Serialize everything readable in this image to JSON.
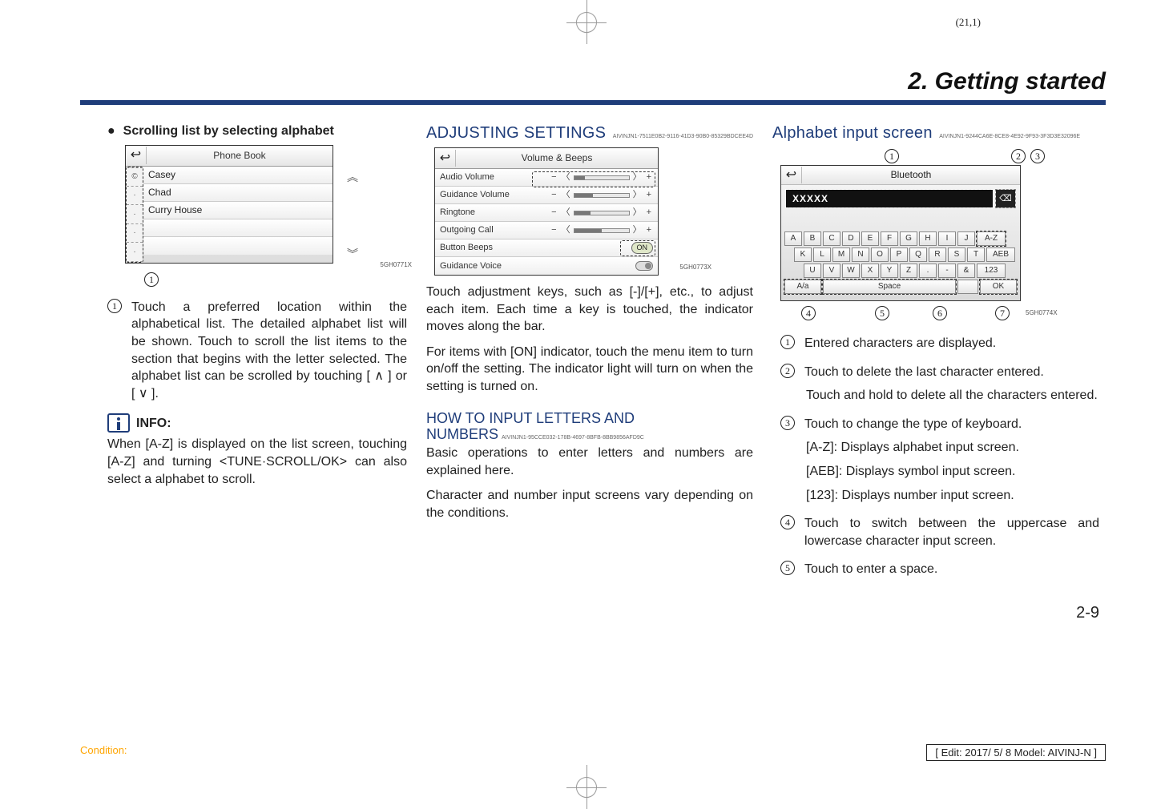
{
  "meta": {
    "page_coord": "(21,1)",
    "chapter_title": "2. Getting started",
    "page_number": "2-9",
    "footer_condition": "Condition:",
    "footer_edit": "[ Edit: 2017/ 5/ 8   Model: AIVINJ-N ]"
  },
  "col1": {
    "bullet_heading": "Scrolling list by selecting alphabet",
    "fig": {
      "header_title": "Phone Book",
      "rows": [
        "Casey",
        "Chad",
        "Curry House"
      ],
      "code": "5GH0771X"
    },
    "item1_marker": "①",
    "item1_text": "Touch a preferred location within the alphabetical list. The detailed alphabet list will be shown. Touch to scroll the list items to the section that begins with the letter selected. The alphabet list can be scrolled by touching [ ∧ ] or [ ∨ ].",
    "info_label": "INFO:",
    "info_text": "When [A-Z] is displayed on the list screen, touching [A-Z] and turning <TUNE·SCROLL/OK> can also select a alphabet to scroll."
  },
  "col2": {
    "h2": "ADJUSTING SETTINGS",
    "h2_guid": "AIVINJN1-7511E0B2-9116-41D3-90B0-85329BDCEE4D",
    "fig": {
      "header_title": "Volume & Beeps",
      "rows": [
        {
          "label": "Audio Volume",
          "type": "slider"
        },
        {
          "label": "Guidance Volume",
          "type": "slider"
        },
        {
          "label": "Ringtone",
          "type": "slider"
        },
        {
          "label": "Outgoing Call",
          "type": "slider"
        },
        {
          "label": "Button Beeps",
          "type": "on"
        },
        {
          "label": "Guidance Voice",
          "type": "toggle"
        }
      ],
      "on_label": "ON",
      "code": "5GH0773X"
    },
    "para1": "Touch adjustment keys, such as [-]/[+], etc., to adjust each item. Each time a key is touched, the indicator moves along the bar.",
    "para2": "For items with [ON] indicator, touch the menu item to turn on/off the setting. The indicator light will turn on when the setting is turned on.",
    "h3_line1": "HOW TO INPUT LETTERS AND",
    "h3_line2": "NUMBERS",
    "h3_guid": "AIVINJN1-95CCE032-178B-4697-8BFB-8BB9856AFD9C",
    "para3": "Basic operations to enter letters and numbers are explained here.",
    "para4": "Character and number input screens vary depending on the conditions."
  },
  "col3": {
    "h2": "Alphabet input screen",
    "h2_guid": "AIVINJN1-9244CA6E-8CE8-4E92-9F93-3F3D3E32096E",
    "fig": {
      "header_title": "Bluetooth",
      "input_text": "XXXXX",
      "del_glyph": "⌫",
      "row1": [
        "A",
        "B",
        "C",
        "D",
        "E",
        "F",
        "G",
        "H",
        "I",
        "J",
        "A-Z"
      ],
      "row2": [
        "K",
        "L",
        "M",
        "N",
        "O",
        "P",
        "Q",
        "R",
        "S",
        "T",
        "AEB"
      ],
      "row3": [
        "U",
        "V",
        "W",
        "X",
        "Y",
        "Z",
        ".",
        "-",
        "&",
        "123"
      ],
      "row4_left": "A/a",
      "row4_space": "Space",
      "row4_ok": "OK",
      "code": "5GH0774X"
    },
    "callouts": {
      "c1": "①",
      "c2": "②",
      "c3": "③",
      "c4": "④",
      "c5": "⑤",
      "c6": "⑥",
      "c7": "⑦"
    },
    "item1_marker": "①",
    "item1_text": "Entered characters are displayed.",
    "item2_marker": "②",
    "item2_text": "Touch to delete the last character entered.",
    "item2_sub": "Touch and hold to delete all the characters entered.",
    "item3_marker": "③",
    "item3_text": "Touch to change the type of keyboard.",
    "item3_line1": "[A-Z]: Displays alphabet input screen.",
    "item3_line2": "[AEB]: Displays symbol input screen.",
    "item3_line3": "[123]: Displays number input screen.",
    "item4_marker": "④",
    "item4_text": "Touch to switch between the uppercase and lowercase character input screen.",
    "item5_marker": "⑤",
    "item5_text": "Touch to enter a space."
  }
}
